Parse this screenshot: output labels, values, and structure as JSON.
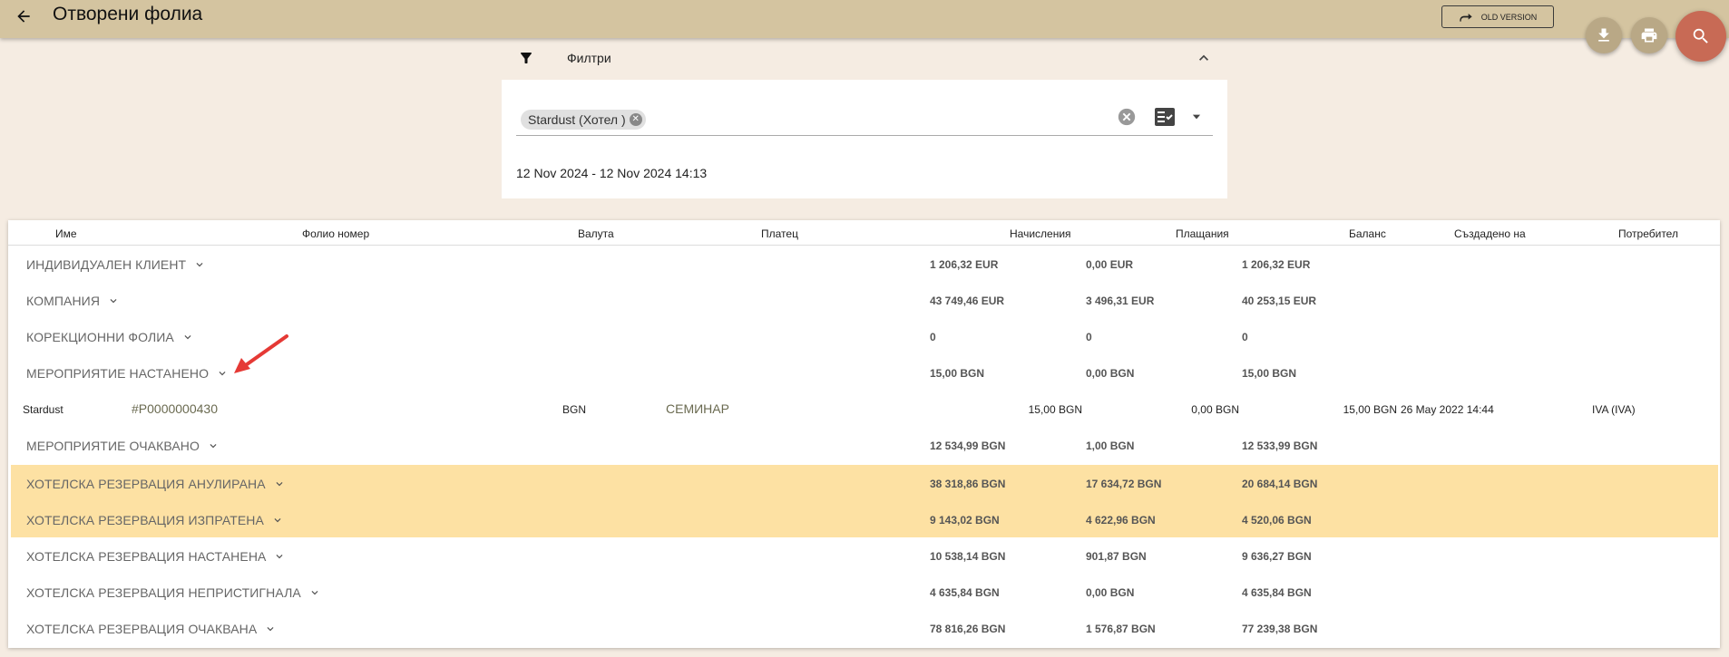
{
  "header": {
    "title": "Отворени фолиа",
    "old_version_label": "OLD VERSION"
  },
  "filters": {
    "label": "Филтри",
    "chip_label": "Stardust (Хотел )",
    "date_range": "12 Nov 2024 - 12 Nov 2024 14:13"
  },
  "table": {
    "columns": {
      "name": "Име",
      "folio_number": "Фолио номер",
      "currency": "Валута",
      "payer": "Платец",
      "charges": "Начисления",
      "payments": "Плащания",
      "balance": "Баланс",
      "created_at": "Създадено на",
      "user": "Потребител"
    },
    "groups": [
      {
        "label": "ИНДИВИДУАЛЕН КЛИЕНТ",
        "charges": "1 206,32 EUR",
        "payments": "0,00 EUR",
        "balance": "1 206,32 EUR"
      },
      {
        "label": "КОМПАНИЯ",
        "charges": "43 749,46 EUR",
        "payments": "3 496,31 EUR",
        "balance": "40 253,15 EUR"
      },
      {
        "label": "КОРЕКЦИОННИ ФОЛИА",
        "charges": "0",
        "payments": "0",
        "balance": "0"
      },
      {
        "label": "МЕРОПРИЯТИЕ НАСТАНЕНО",
        "charges": "15,00 BGN",
        "payments": "0,00 BGN",
        "balance": "15,00 BGN"
      },
      {
        "label": "МЕРОПРИЯТИЕ ОЧАКВАНО",
        "charges": "12 534,99 BGN",
        "payments": "1,00 BGN",
        "balance": "12 533,99 BGN"
      },
      {
        "label": "ХОТЕЛСКА РЕЗЕРВАЦИЯ АНУЛИРАНА",
        "charges": "38 318,86 BGN",
        "payments": "17 634,72 BGN",
        "balance": "20 684,14 BGN"
      },
      {
        "label": "ХОТЕЛСКА РЕЗЕРВАЦИЯ ИЗПРАТЕНА",
        "charges": "9 143,02 BGN",
        "payments": "4 622,96 BGN",
        "balance": "4 520,06 BGN"
      },
      {
        "label": "ХОТЕЛСКА РЕЗЕРВАЦИЯ НАСТАНЕНА",
        "charges": "10 538,14 BGN",
        "payments": "901,87 BGN",
        "balance": "9 636,27 BGN"
      },
      {
        "label": "ХОТЕЛСКА РЕЗЕРВАЦИЯ НЕПРИСТИГНАЛА",
        "charges": "4 635,84 BGN",
        "payments": "0,00 BGN",
        "balance": "4 635,84 BGN"
      },
      {
        "label": "ХОТЕЛСКА РЕЗЕРВАЦИЯ ОЧАКВАНА",
        "charges": "78 816,26 BGN",
        "payments": "1 576,87 BGN",
        "balance": "77 239,38 BGN"
      }
    ],
    "detail_row": {
      "name": "Stardust",
      "folio_number": "#P0000000430",
      "currency": "BGN",
      "payer": "СЕМИНАР",
      "charges": "15,00 BGN",
      "payments": "0,00 BGN",
      "balance": "15,00 BGN",
      "created_at": "26 May 2022 14:44",
      "user": "IVA (IVA)"
    }
  },
  "colors": {
    "topbar": "#d4c4a0",
    "background": "#f5ece2",
    "highlight_row": "#fde1a3",
    "search_fab": "#c86a55",
    "small_fab": "#b9a886",
    "annotation_arrow": "#e53935"
  }
}
